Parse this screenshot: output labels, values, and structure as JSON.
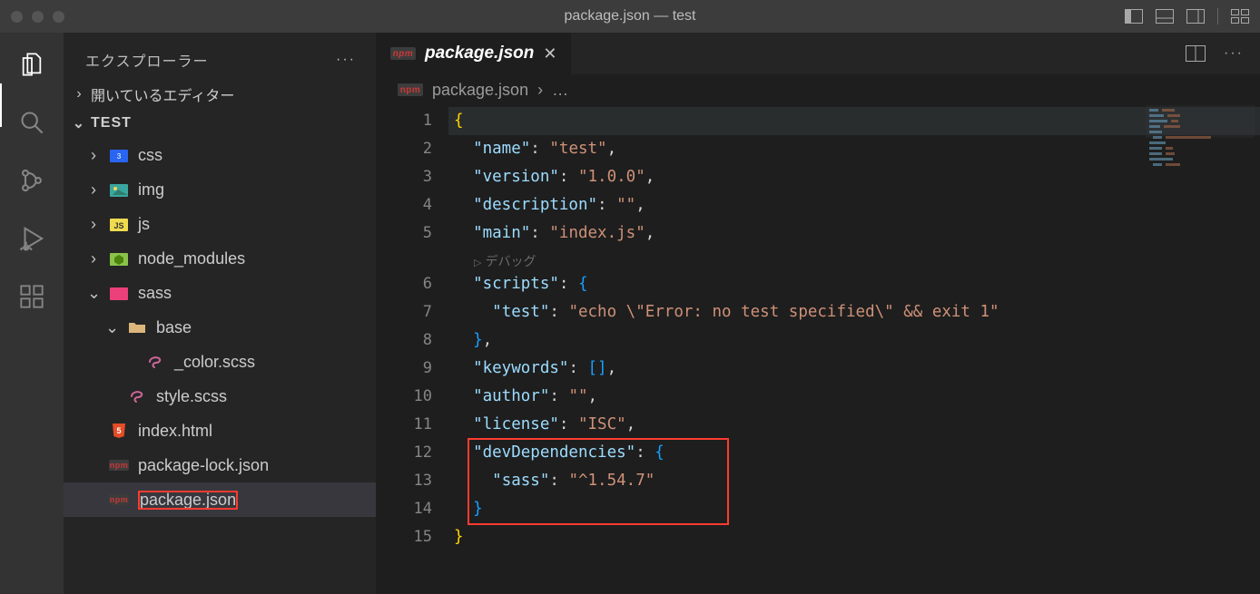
{
  "titlebar": {
    "title": "package.json — test"
  },
  "sidebar": {
    "title": "エクスプローラー",
    "open_editors": "開いているエディター",
    "root": "TEST",
    "tree": {
      "css": "css",
      "img": "img",
      "js": "js",
      "node_modules": "node_modules",
      "sass": "sass",
      "base": "base",
      "color_scss": "_color.scss",
      "style_scss": "style.scss",
      "index_html": "index.html",
      "package_lock": "package-lock.json",
      "package_json": "package.json"
    }
  },
  "tab": {
    "label": "package.json",
    "npm_label": "npm"
  },
  "breadcrumb": {
    "file": "package.json",
    "rest": "…"
  },
  "editor": {
    "debug_hint": "デバッグ",
    "line_numbers": [
      "1",
      "2",
      "3",
      "4",
      "5",
      "6",
      "7",
      "8",
      "9",
      "10",
      "11",
      "12",
      "13",
      "14",
      "15"
    ],
    "json": {
      "name_key": "\"name\"",
      "name_val": "\"test\"",
      "version_key": "\"version\"",
      "version_val": "\"1.0.0\"",
      "description_key": "\"description\"",
      "description_val": "\"\"",
      "main_key": "\"main\"",
      "main_val": "\"index.js\"",
      "scripts_key": "\"scripts\"",
      "test_key": "\"test\"",
      "test_val": "\"echo \\\"Error: no test specified\\\" && exit 1\"",
      "keywords_key": "\"keywords\"",
      "author_key": "\"author\"",
      "author_val": "\"\"",
      "license_key": "\"license\"",
      "license_val": "\"ISC\"",
      "devdeps_key": "\"devDependencies\"",
      "sass_key": "\"sass\"",
      "sass_val": "\"^1.54.7\""
    }
  },
  "chart_data": {
    "type": "table",
    "title": "package.json contents",
    "data": {
      "name": "test",
      "version": "1.0.0",
      "description": "",
      "main": "index.js",
      "scripts": {
        "test": "echo \"Error: no test specified\" && exit 1"
      },
      "keywords": [],
      "author": "",
      "license": "ISC",
      "devDependencies": {
        "sass": "^1.54.7"
      }
    }
  }
}
